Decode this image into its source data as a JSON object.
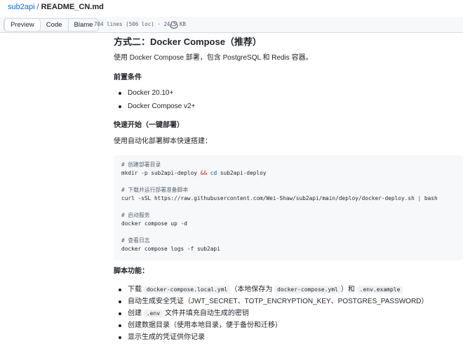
{
  "breadcrumb": {
    "repo": "sub2api",
    "separator": "/",
    "file": "README_CN.md"
  },
  "toolbar": {
    "tabs": [
      {
        "label": "Preview"
      },
      {
        "label": "Code"
      },
      {
        "label": "Blame"
      }
    ],
    "meta": "704 lines (506 loc) · 24.5 KB",
    "copilot_icon": "copilot-icon"
  },
  "doc": {
    "heading": "方式二：Docker Compose（推荐）",
    "intro": "使用 Docker Compose 部署，包含 PostgreSQL 和 Redis 容器。",
    "prereq_title": "前置条件",
    "prereqs": [
      "Docker 20.10+",
      "Docker Compose v2+"
    ],
    "quickstart_title": "快速开始（一键部署）",
    "quickstart_intro": "使用自动化部署脚本快速搭建：",
    "code": {
      "c1": "# 创建部署目录",
      "l1_a": "mkdir -p sub2api-deploy ",
      "l1_op": "&&",
      "l1_sp": " ",
      "l1_cd": "cd",
      "l1_b": " sub2api-deploy",
      "c2": "# 下载并运行部署准备脚本",
      "l2_a": "curl -sSL https://raw.githubusercontent.com/Wei-Shaw/sub2api/main/deploy/docker-deploy.sh ",
      "l2_pipe": "|",
      "l2_b": " bash",
      "c3": "# 启动服务",
      "l3": "docker compose up -d",
      "c4": "# 查看日志",
      "l4": "docker compose logs -f sub2api"
    },
    "features_title": "脚本功能：",
    "features": {
      "f1_a": "下载 ",
      "f1_code1": "docker-compose.local.yml",
      "f1_b": "（本地保存为 ",
      "f1_code2": "docker-compose.yml",
      "f1_c": "）和 ",
      "f1_code3": ".env.example",
      "f2": "自动生成安全凭证（JWT_SECRET、TOTP_ENCRYPTION_KEY、POSTGRES_PASSWORD）",
      "f3_a": "创建 ",
      "f3_code": ".env",
      "f3_b": " 文件并填充自动生成的密钥",
      "f4": "创建数据目录（使用本地目录，便于备份和迁移）",
      "f5": "显示生成的凭证供你记录"
    }
  }
}
